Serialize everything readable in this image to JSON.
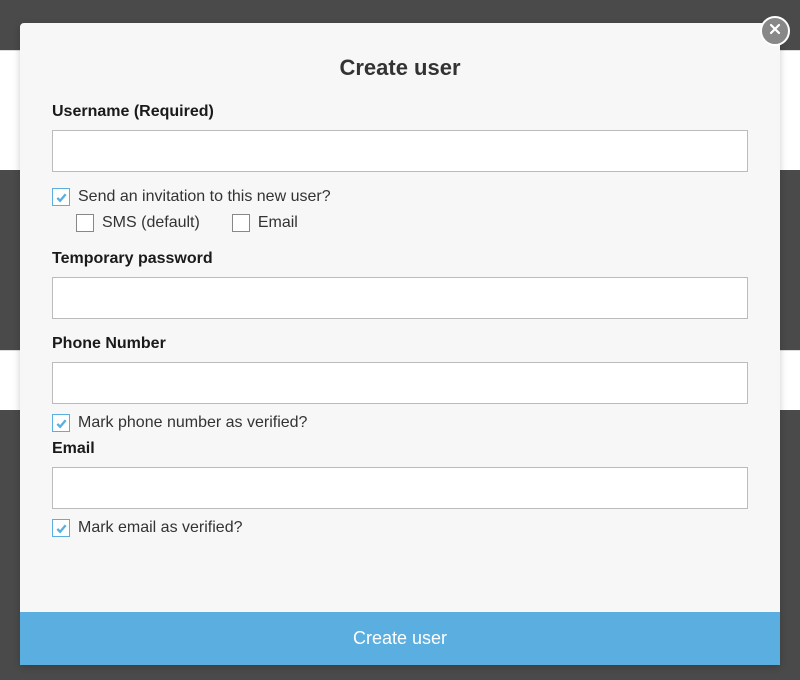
{
  "modal": {
    "title": "Create user",
    "fields": {
      "username_label": "Username (Required)",
      "username_value": "",
      "invite_label": "Send an invitation to this new user?",
      "invite_checked": true,
      "invite_sms_label": "SMS (default)",
      "invite_sms_checked": false,
      "invite_email_label": "Email",
      "invite_email_checked": false,
      "temp_pw_label": "Temporary password",
      "temp_pw_value": "",
      "phone_label": "Phone Number",
      "phone_value": "",
      "phone_verified_label": "Mark phone number as verified?",
      "phone_verified_checked": true,
      "email_label": "Email",
      "email_value": "",
      "email_verified_label": "Mark email as verified?",
      "email_verified_checked": true
    },
    "submit_label": "Create user"
  }
}
